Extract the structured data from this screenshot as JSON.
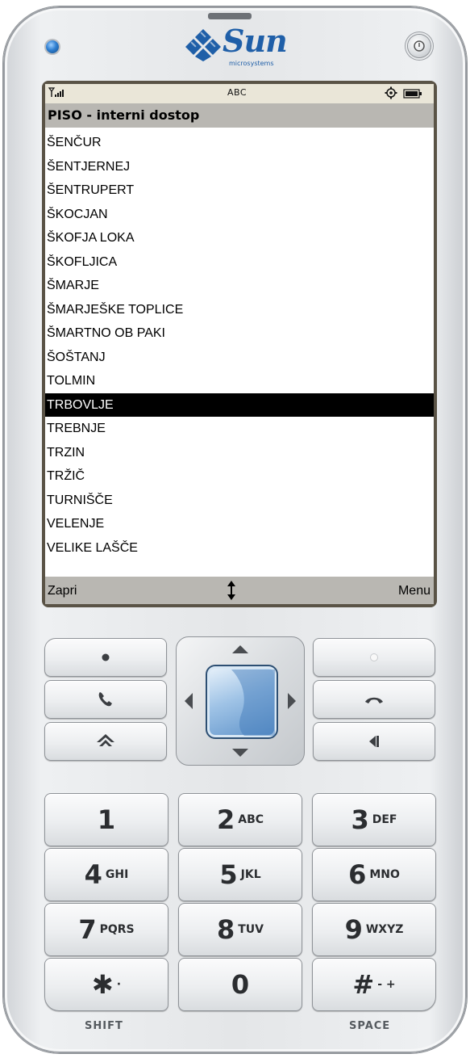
{
  "device": {
    "brand": "Sun",
    "brand_sub": "microsystems"
  },
  "status": {
    "input_mode": "ABC"
  },
  "app": {
    "title": "PISO - interni dostop"
  },
  "list": {
    "items": [
      "ŠENČUR",
      "ŠENTJERNEJ",
      "ŠENTRUPERT",
      "ŠKOCJAN",
      "ŠKOFJA LOKA",
      "ŠKOFLJICA",
      "ŠMARJE",
      "ŠMARJEŠKE TOPLICE",
      "ŠMARTNO OB PAKI",
      "ŠOŠTANJ",
      "TOLMIN",
      "TRBOVLJE",
      "TREBNJE",
      "TRZIN",
      "TRŽIČ",
      "TURNIŠČE",
      "VELENJE",
      "VELIKE LAŠČE"
    ],
    "selected": "TRBOVLJE"
  },
  "softkeys": {
    "left": "Zapri",
    "right": "Menu"
  },
  "keypad": {
    "keys": [
      {
        "num": "1",
        "letters": ""
      },
      {
        "num": "2",
        "letters": "ABC"
      },
      {
        "num": "3",
        "letters": "DEF"
      },
      {
        "num": "4",
        "letters": "GHI"
      },
      {
        "num": "5",
        "letters": "JKL"
      },
      {
        "num": "6",
        "letters": "MNO"
      },
      {
        "num": "7",
        "letters": "PQRS"
      },
      {
        "num": "8",
        "letters": "TUV"
      },
      {
        "num": "9",
        "letters": "WXYZ"
      },
      {
        "num": "✱",
        "letters": "·"
      },
      {
        "num": "0",
        "letters": ""
      },
      {
        "num": "#",
        "letters": "- +"
      }
    ],
    "shift_label": "SHIFT",
    "space_label": "SPACE"
  },
  "colors": {
    "selection_bg": "#000000",
    "bar_bg": "#b9b7b2",
    "brand": "#1f5fa8"
  }
}
